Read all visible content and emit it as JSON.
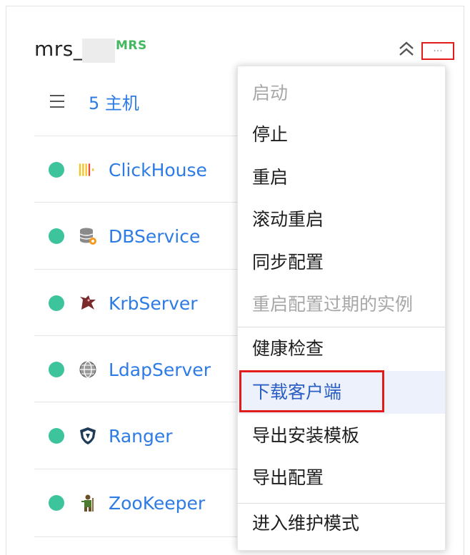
{
  "cluster": {
    "name": "mrs_",
    "type_badge": "MRS",
    "more_label": "..."
  },
  "hosts": {
    "label": "5 主机"
  },
  "services": [
    {
      "name": "ClickHouse",
      "status": "running",
      "icon": "clickhouse-icon"
    },
    {
      "name": "DBService",
      "status": "running",
      "icon": "dbservice-icon"
    },
    {
      "name": "KrbServer",
      "status": "running",
      "icon": "krbserver-icon"
    },
    {
      "name": "LdapServer",
      "status": "running",
      "icon": "ldapserver-icon"
    },
    {
      "name": "Ranger",
      "status": "running",
      "icon": "ranger-icon"
    },
    {
      "name": "ZooKeeper",
      "status": "running",
      "icon": "zookeeper-icon"
    }
  ],
  "menu": {
    "items": [
      {
        "label": "启动",
        "enabled": false
      },
      {
        "label": "停止",
        "enabled": true
      },
      {
        "label": "重启",
        "enabled": true
      },
      {
        "label": "滚动重启",
        "enabled": true
      },
      {
        "label": "同步配置",
        "enabled": true
      },
      {
        "label": "重启配置过期的实例",
        "enabled": false
      },
      {
        "label": "健康检查",
        "enabled": true
      },
      {
        "label": "下载客户端",
        "enabled": true,
        "hovered": true
      },
      {
        "label": "导出安装模板",
        "enabled": true
      },
      {
        "label": "导出配置",
        "enabled": true
      },
      {
        "label": "进入维护模式",
        "enabled": true
      }
    ]
  },
  "colors": {
    "accent": "#2d7be5",
    "status_running": "#3dc49c",
    "badge": "#43b85e",
    "annotation": "#e21b1b"
  }
}
